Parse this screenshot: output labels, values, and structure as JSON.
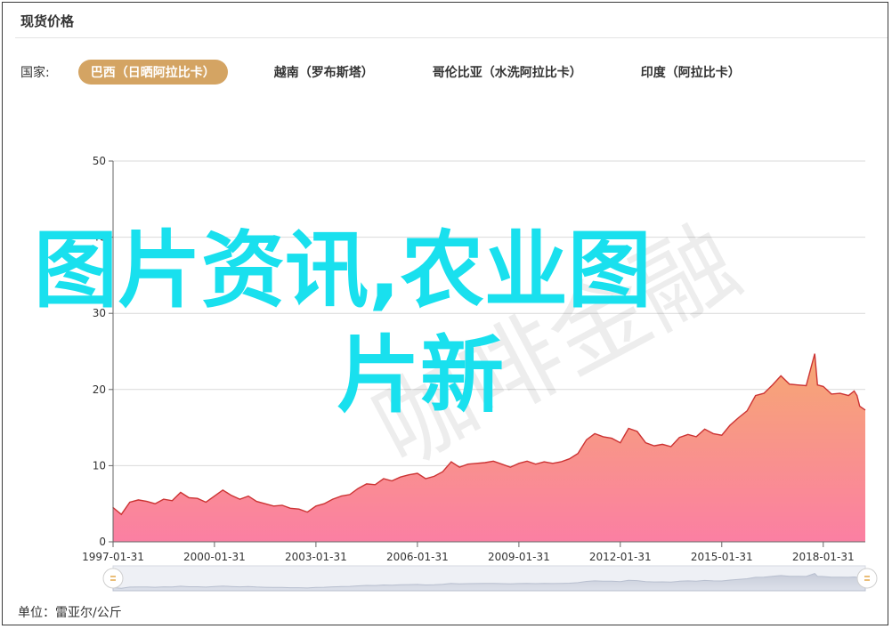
{
  "header": {
    "title": "现货价格"
  },
  "countries": {
    "label": "国家:",
    "items": [
      {
        "label": "巴西（日晒阿拉比卡）",
        "active": true
      },
      {
        "label": "越南（罗布斯塔）",
        "active": false
      },
      {
        "label": "哥伦比亚（水洗阿拉比卡）",
        "active": false
      },
      {
        "label": "印度（阿拉比卡）",
        "active": false
      }
    ]
  },
  "unit_label": "单位：雷亚尔/公斤",
  "overlay": {
    "line1": "图片资讯,农业图",
    "line2": "片新"
  },
  "watermark": "咖啡金融",
  "colors": {
    "accent": "#d4a463",
    "line": "#cc3333",
    "fill_top": "#f6a872",
    "fill_bottom": "#fb7fa3",
    "overlay": "#19e0ee"
  },
  "chart_data": {
    "type": "area",
    "title": "",
    "xlabel": "",
    "ylabel": "",
    "ylim": [
      0,
      50
    ],
    "yticks": [
      0,
      10,
      20,
      30,
      40,
      50
    ],
    "xlim": [
      "1997-01-31",
      "2019-04-30"
    ],
    "xticks": [
      "1997-01-31",
      "2000-01-31",
      "2003-01-31",
      "2006-01-31",
      "2009-01-31",
      "2012-01-31",
      "2015-01-31",
      "2018-01-31"
    ],
    "grid": true,
    "series": [
      {
        "name": "",
        "points": [
          [
            "1997-01-31",
            4.5
          ],
          [
            "1997-04-30",
            3.6
          ],
          [
            "1997-07-31",
            5.2
          ],
          [
            "1997-10-31",
            5.5
          ],
          [
            "1998-01-31",
            5.3
          ],
          [
            "1998-04-30",
            5.0
          ],
          [
            "1998-07-31",
            5.6
          ],
          [
            "1998-10-31",
            5.4
          ],
          [
            "1999-01-31",
            6.5
          ],
          [
            "1999-04-30",
            5.8
          ],
          [
            "1999-07-31",
            5.7
          ],
          [
            "1999-10-31",
            5.2
          ],
          [
            "2000-01-31",
            6.0
          ],
          [
            "2000-04-30",
            6.8
          ],
          [
            "2000-07-31",
            6.1
          ],
          [
            "2000-10-31",
            5.6
          ],
          [
            "2001-01-31",
            6.0
          ],
          [
            "2001-04-30",
            5.3
          ],
          [
            "2001-07-31",
            5.0
          ],
          [
            "2001-10-31",
            4.7
          ],
          [
            "2002-01-31",
            4.8
          ],
          [
            "2002-04-30",
            4.4
          ],
          [
            "2002-07-31",
            4.3
          ],
          [
            "2002-10-31",
            3.9
          ],
          [
            "2003-01-31",
            4.7
          ],
          [
            "2003-04-30",
            5.0
          ],
          [
            "2003-07-31",
            5.6
          ],
          [
            "2003-10-31",
            6.0
          ],
          [
            "2004-01-31",
            6.2
          ],
          [
            "2004-04-30",
            7.0
          ],
          [
            "2004-07-31",
            7.6
          ],
          [
            "2004-10-31",
            7.5
          ],
          [
            "2005-01-31",
            8.3
          ],
          [
            "2005-04-30",
            8.0
          ],
          [
            "2005-07-31",
            8.5
          ],
          [
            "2005-10-31",
            8.8
          ],
          [
            "2006-01-31",
            9.0
          ],
          [
            "2006-04-30",
            8.3
          ],
          [
            "2006-07-31",
            8.6
          ],
          [
            "2006-10-31",
            9.2
          ],
          [
            "2007-01-31",
            10.5
          ],
          [
            "2007-04-30",
            9.8
          ],
          [
            "2007-07-31",
            10.2
          ],
          [
            "2007-10-31",
            10.3
          ],
          [
            "2008-01-31",
            10.4
          ],
          [
            "2008-04-30",
            10.6
          ],
          [
            "2008-07-31",
            10.2
          ],
          [
            "2008-10-31",
            9.8
          ],
          [
            "2009-01-31",
            10.3
          ],
          [
            "2009-04-30",
            10.6
          ],
          [
            "2009-07-31",
            10.2
          ],
          [
            "2009-10-31",
            10.5
          ],
          [
            "2010-01-31",
            10.3
          ],
          [
            "2010-04-30",
            10.5
          ],
          [
            "2010-07-31",
            10.9
          ],
          [
            "2010-10-31",
            11.6
          ],
          [
            "2011-01-31",
            13.4
          ],
          [
            "2011-04-30",
            14.2
          ],
          [
            "2011-07-31",
            13.8
          ],
          [
            "2011-10-31",
            13.6
          ],
          [
            "2012-01-31",
            13.0
          ],
          [
            "2012-04-30",
            14.9
          ],
          [
            "2012-07-31",
            14.5
          ],
          [
            "2012-10-31",
            13.0
          ],
          [
            "2013-01-31",
            12.6
          ],
          [
            "2013-04-30",
            12.8
          ],
          [
            "2013-07-31",
            12.5
          ],
          [
            "2013-10-31",
            13.7
          ],
          [
            "2014-01-31",
            14.1
          ],
          [
            "2014-04-30",
            13.8
          ],
          [
            "2014-07-31",
            14.8
          ],
          [
            "2014-10-31",
            14.2
          ],
          [
            "2015-01-31",
            14.0
          ],
          [
            "2015-04-30",
            15.3
          ],
          [
            "2015-07-31",
            16.3
          ],
          [
            "2015-10-31",
            17.2
          ],
          [
            "2016-01-31",
            19.2
          ],
          [
            "2016-04-30",
            19.5
          ],
          [
            "2016-07-31",
            20.6
          ],
          [
            "2016-10-31",
            21.8
          ],
          [
            "2017-01-31",
            20.7
          ],
          [
            "2017-04-30",
            20.6
          ],
          [
            "2017-07-31",
            20.5
          ],
          [
            "2017-10-31",
            24.7
          ],
          [
            "2017-11-30",
            20.6
          ],
          [
            "2018-01-31",
            20.4
          ],
          [
            "2018-04-30",
            19.4
          ],
          [
            "2018-07-31",
            19.5
          ],
          [
            "2018-10-31",
            19.2
          ],
          [
            "2018-12-31",
            19.8
          ],
          [
            "2019-01-31",
            19.2
          ],
          [
            "2019-02-28",
            17.8
          ],
          [
            "2019-04-30",
            17.3
          ]
        ]
      }
    ]
  }
}
